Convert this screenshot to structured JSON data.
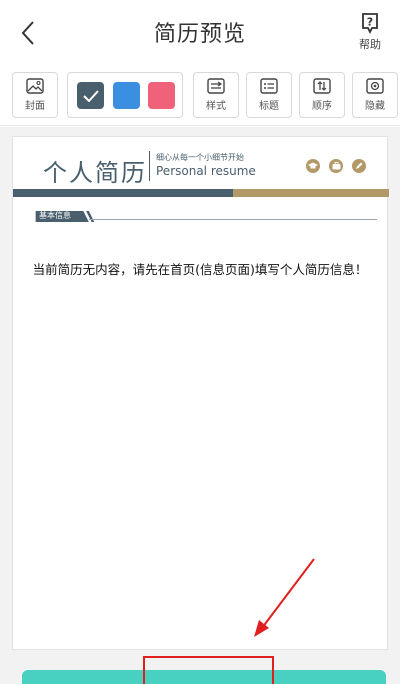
{
  "header": {
    "title": "简历预览",
    "back_icon": "chevron-left-icon",
    "help_label": "帮助",
    "help_icon": "question-bubble-icon"
  },
  "toolbar": {
    "cover_label": "封面",
    "style_label": "样式",
    "heading_label": "标题",
    "order_label": "顺序",
    "hide_label": "隐藏",
    "swatches": [
      {
        "color": "#4a5f6e",
        "selected": true
      },
      {
        "color": "#3b8fe0",
        "selected": false
      },
      {
        "color": "#f0627a",
        "selected": false
      }
    ]
  },
  "resume": {
    "title": "个人简历",
    "slogan": "细心从每一个小细节开始",
    "subtitle": "Personal resume",
    "section_label": "基本信息",
    "empty_message": "当前简历无内容，请先在首页(信息页面)填写个人简历信息！",
    "accent_color": "#4a5f6e",
    "gold_color": "#b39968"
  },
  "annotation": {
    "color": "#e0201e"
  }
}
